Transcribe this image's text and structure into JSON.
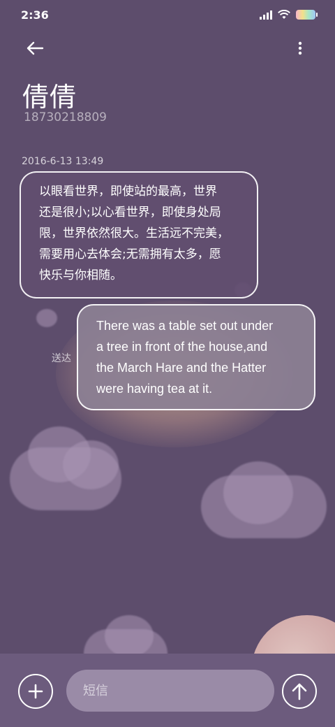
{
  "status_bar": {
    "time": "2:36",
    "icons": [
      "signal-icon",
      "wifi-icon",
      "battery-icon"
    ]
  },
  "header": {
    "back_icon": "arrow-left-icon",
    "more_icon": "more-vertical-icon",
    "contact_name": "倩倩",
    "contact_number": "18730218809"
  },
  "conversation": {
    "timestamp": "2016-6-13 13:49",
    "messages": [
      {
        "direction": "incoming",
        "lines": [
          "以眼看世界，即使站的最高，世界",
          "还是很小;以心看世界，即使身处局",
          "限，世界依然很大。生活远不完美，",
          "需要用心去体会;无需拥有太多，愿",
          "快乐与你相随。"
        ]
      },
      {
        "direction": "outgoing",
        "lines": [
          "There was a table set out under",
          "a tree in front of the house,and",
          "the March Hare and the Hatter",
          "were having tea at it."
        ],
        "status": "送达"
      }
    ]
  },
  "composer": {
    "add_icon": "plus-icon",
    "placeholder": "短信",
    "send_icon": "arrow-up-icon"
  },
  "colors": {
    "background": "#5d4d6c",
    "bottom_bar": "#6c5b7d",
    "incoming_bubble": "#624e70",
    "outgoing_bubble": "#8c8094"
  }
}
